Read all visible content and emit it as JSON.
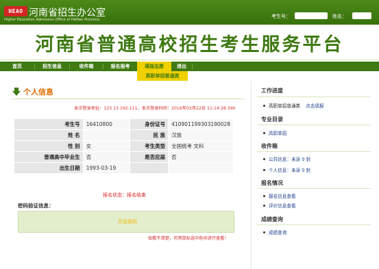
{
  "header": {
    "logo_text": "HEAO",
    "org_name": "河南省招生办公室",
    "org_subtitle": "Higher Education Admission Office of HeNan Province",
    "exam_no_label": "考生号：",
    "name_label": "姓名：",
    "platform_title": "河南省普通高校招生考生服务平台"
  },
  "nav": {
    "items": [
      "首页",
      "招生信息",
      "收件箱",
      "报名报考",
      "填报志愿",
      "退出"
    ],
    "active": "填报志愿",
    "subnav": "高职单招普通类"
  },
  "main": {
    "section_title": "个人信息",
    "login_info": "本次登录地址：123.13.192.111，本次登录时间：2016年03月22日 11:14:28.340",
    "profile": {
      "exam_no_label": "考生号",
      "exam_no_value": "16410800",
      "id_label": "身份证号",
      "id_value": "410901199303190028",
      "name_label": "姓  名",
      "name_value": "",
      "ethnicity_label": "民  族",
      "ethnicity_value": "汉族",
      "gender_label": "性  别",
      "gender_value": "女",
      "type_label": "考生类型",
      "type_value": "全国统考  文科",
      "hs_grad_label": "普通高中毕业生",
      "hs_grad_value": "否",
      "fresh_label": "是否应届",
      "fresh_value": "否",
      "dob_label": "出生日期",
      "dob_value": "1993-03-19"
    },
    "status_text": "报名状态：报名结束",
    "pwd_label": "密码验证信息：",
    "pwd_button": "开启密码",
    "refresh_hint": "如看不清楚，可用鼠标选中色块进行查看！"
  },
  "sidebar": {
    "sections": [
      {
        "title": "工作进度",
        "items": [
          {
            "label": "高职单招普通类",
            "link": "点击填报"
          }
        ]
      },
      {
        "title": "专业目录",
        "items": [
          {
            "label": "高职单招"
          }
        ]
      },
      {
        "title": "收件箱",
        "items": [
          {
            "label": "公共信息：",
            "suffix": "未读  0  封"
          },
          {
            "label": "个人信息：",
            "suffix": "未读  0  封"
          }
        ]
      },
      {
        "title": "报名情况",
        "items": [
          {
            "label": "报名信息查看"
          },
          {
            "label": "评价信息查看"
          }
        ]
      },
      {
        "title": "成绩查询",
        "items": [
          {
            "label": "成绩查询"
          }
        ]
      }
    ]
  },
  "colors": {
    "brand_green": "#3f7a12",
    "nav_active_yellow": "#f1d000",
    "alert_red": "#d62a2a",
    "title_orange": "#e06a00"
  }
}
